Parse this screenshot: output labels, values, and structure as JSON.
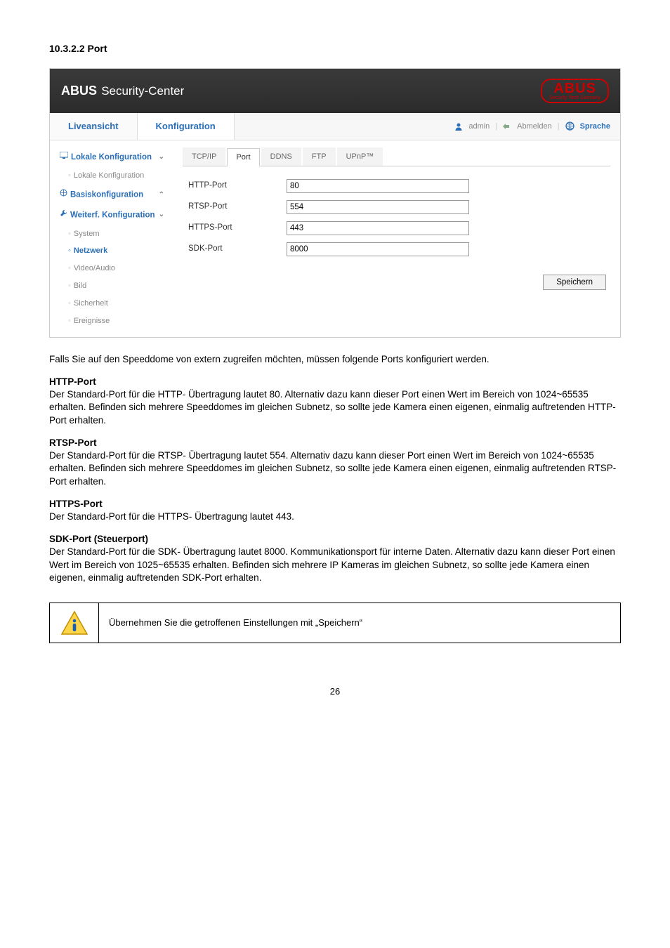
{
  "section_title": "10.3.2.2 Port",
  "header": {
    "brand": "ABUS",
    "brand_sub": "Security-Center",
    "logo_text": "ABUS",
    "logo_sub": "Security Tech Germany"
  },
  "nav": {
    "tabs": [
      {
        "label": "Liveansicht",
        "active": false
      },
      {
        "label": "Konfiguration",
        "active": true
      }
    ],
    "user_label": "admin",
    "logout_label": "Abmelden",
    "lang_label": "Sprache"
  },
  "sidebar": {
    "groups": [
      {
        "label": "Lokale Konfiguration",
        "bold": true,
        "chev": "⌄",
        "icon": "screen"
      },
      {
        "label": "Lokale Konfiguration",
        "child": true
      },
      {
        "label": "Basiskonfiguration",
        "bold": true,
        "chev": "⌃",
        "icon": "globe"
      },
      {
        "label": "Weiterf. Konfiguration",
        "bold": true,
        "chev": "⌄",
        "icon": "wrench"
      },
      {
        "label": "System",
        "child": true
      },
      {
        "label": "Netzwerk",
        "child": true,
        "active": true
      },
      {
        "label": "Video/Audio",
        "child": true
      },
      {
        "label": "Bild",
        "child": true
      },
      {
        "label": "Sicherheit",
        "child": true
      },
      {
        "label": "Ereignisse",
        "child": true
      }
    ]
  },
  "tabs2": [
    {
      "label": "TCP/IP"
    },
    {
      "label": "Port",
      "active": true
    },
    {
      "label": "DDNS"
    },
    {
      "label": "FTP"
    },
    {
      "label": "UPnP™"
    }
  ],
  "form": {
    "rows": [
      {
        "label": "HTTP-Port",
        "value": "80"
      },
      {
        "label": "RTSP-Port",
        "value": "554"
      },
      {
        "label": "HTTPS-Port",
        "value": "443"
      },
      {
        "label": "SDK-Port",
        "value": "8000"
      }
    ],
    "save_label": "Speichern"
  },
  "doc": {
    "intro": "Falls Sie auf den Speeddome von extern zugreifen möchten, müssen folgende Ports konfiguriert werden.",
    "sections": [
      {
        "title": "HTTP-Port",
        "body": "Der Standard-Port für die HTTP- Übertragung lautet 80. Alternativ dazu kann dieser Port einen Wert im Bereich von 1024~65535 erhalten. Befinden sich mehrere Speeddomes im gleichen Subnetz, so sollte jede Kamera einen eigenen, einmalig auftretenden HTTP-Port erhalten."
      },
      {
        "title": "RTSP-Port",
        "body": "Der Standard-Port für die RTSP- Übertragung lautet 554. Alternativ dazu kann dieser Port einen Wert im Bereich von 1024~65535 erhalten. Befinden sich mehrere Speeddomes im gleichen Subnetz, so sollte jede Kamera einen eigenen, einmalig auftretenden RTSP-Port erhalten."
      },
      {
        "title": "HTTPS-Port",
        "body": "Der Standard-Port für die HTTPS- Übertragung lautet 443."
      },
      {
        "title": "SDK-Port (Steuerport)",
        "body": "Der Standard-Port für die SDK- Übertragung lautet 8000. Kommunikationsport für interne Daten. Alternativ dazu kann dieser Port einen Wert im Bereich von 1025~65535 erhalten. Befinden sich mehrere IP Kameras im gleichen Subnetz, so sollte jede Kamera einen eigenen, einmalig auftretenden SDK-Port erhalten."
      }
    ],
    "infobox": "Übernehmen Sie die getroffenen Einstellungen mit „Speichern“"
  },
  "page_number": "26"
}
